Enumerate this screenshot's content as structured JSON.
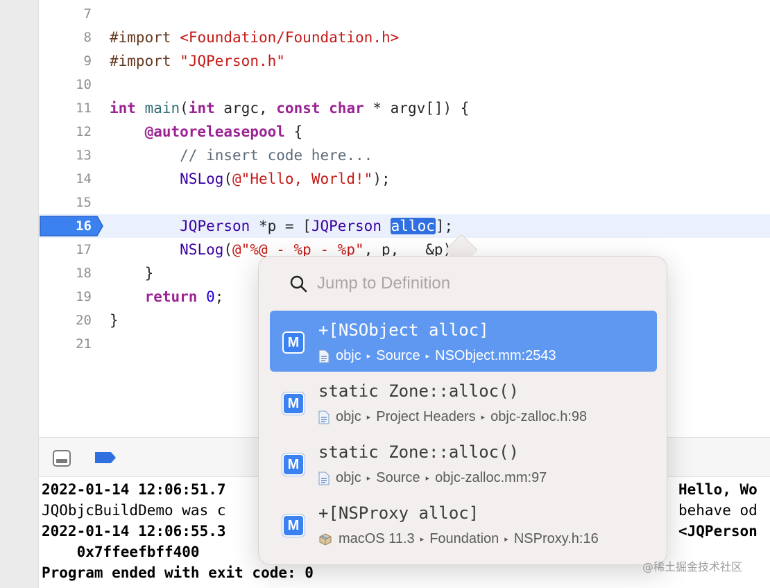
{
  "editor": {
    "lines": [
      {
        "num": "7"
      },
      {
        "num": "8"
      },
      {
        "num": "9"
      },
      {
        "num": "10"
      },
      {
        "num": "11"
      },
      {
        "num": "12"
      },
      {
        "num": "13"
      },
      {
        "num": "14"
      },
      {
        "num": "15"
      },
      {
        "num": "16",
        "breakpoint": true,
        "current": true
      },
      {
        "num": "17"
      },
      {
        "num": "18"
      },
      {
        "num": "19"
      },
      {
        "num": "20"
      },
      {
        "num": "21"
      }
    ],
    "code": {
      "l8": {
        "directive": "#import",
        "path": "<Foundation/Foundation.h>"
      },
      "l9": {
        "directive": "#import",
        "path": "\"JQPerson.h\""
      },
      "l11": {
        "int1": "int",
        "main": "main",
        "paren_open": "(",
        "int2": "int",
        "argc": " argc, ",
        "const": "const",
        "char": "char",
        "rest": " * argv[]) {"
      },
      "l12": {
        "pool": "@autoreleasepool",
        "brace": " {"
      },
      "l13": {
        "comment": "// insert code here..."
      },
      "l14": {
        "fn": "NSLog",
        "open": "(",
        "str": "@\"Hello, World!\"",
        "close": ");"
      },
      "l16": {
        "type": "JQPerson",
        "mid": " *p = [",
        "cls": "JQPerson",
        "space": " ",
        "selected": "alloc",
        "end": "];"
      },
      "l17": {
        "fn": "NSLog",
        "open": "(",
        "str": "@\"%@ - %p - %p\"",
        "rest": ", p,   &p);"
      },
      "l18": {
        "brace": "}"
      },
      "l19": {
        "kw": "return",
        "space": " ",
        "num": "0",
        "semi": ";"
      },
      "l20": {
        "brace": "}"
      }
    }
  },
  "console": {
    "lines": [
      {
        "left": "2022-01-14 12:06:51.7",
        "right": "Hello, Wo",
        "bold": true
      },
      {
        "left": "JQObjcBuildDemo was c",
        "right": "behave od",
        "bold": false
      },
      {
        "left": "2022-01-14 12:06:55.3",
        "right": "<JQPerson",
        "bold": true
      },
      {
        "left": "    0x7ffeefbff400",
        "right": "",
        "bold": true
      },
      {
        "left": "Program ended with exit code: 0",
        "right": "",
        "bold": true
      }
    ]
  },
  "popover": {
    "search_placeholder": "Jump to Definition",
    "results": [
      {
        "badge": "M",
        "title": "+[NSObject alloc]",
        "path": [
          "objc",
          "Source",
          "NSObject.mm:2543"
        ],
        "icon": "header-file-icon",
        "selected": true
      },
      {
        "badge": "M",
        "title": "static Zone::alloc()",
        "path": [
          "objc",
          "Project Headers",
          "objc-zalloc.h:98"
        ],
        "icon": "header-file-icon",
        "selected": false
      },
      {
        "badge": "M",
        "title": "static Zone::alloc()",
        "path": [
          "objc",
          "Source",
          "objc-zalloc.mm:97"
        ],
        "icon": "header-file-icon",
        "selected": false
      },
      {
        "badge": "M",
        "title": "+[NSProxy alloc]",
        "path": [
          "macOS 11.3",
          "Foundation",
          "NSProxy.h:16"
        ],
        "icon": "sdk-package-icon",
        "selected": false
      }
    ]
  },
  "watermark": "@稀土掘金技术社区",
  "colors": {
    "accent": "#2f6fe0",
    "selection_row": "#5e98f0",
    "keyword": "#9b2393",
    "string": "#c41a16"
  }
}
